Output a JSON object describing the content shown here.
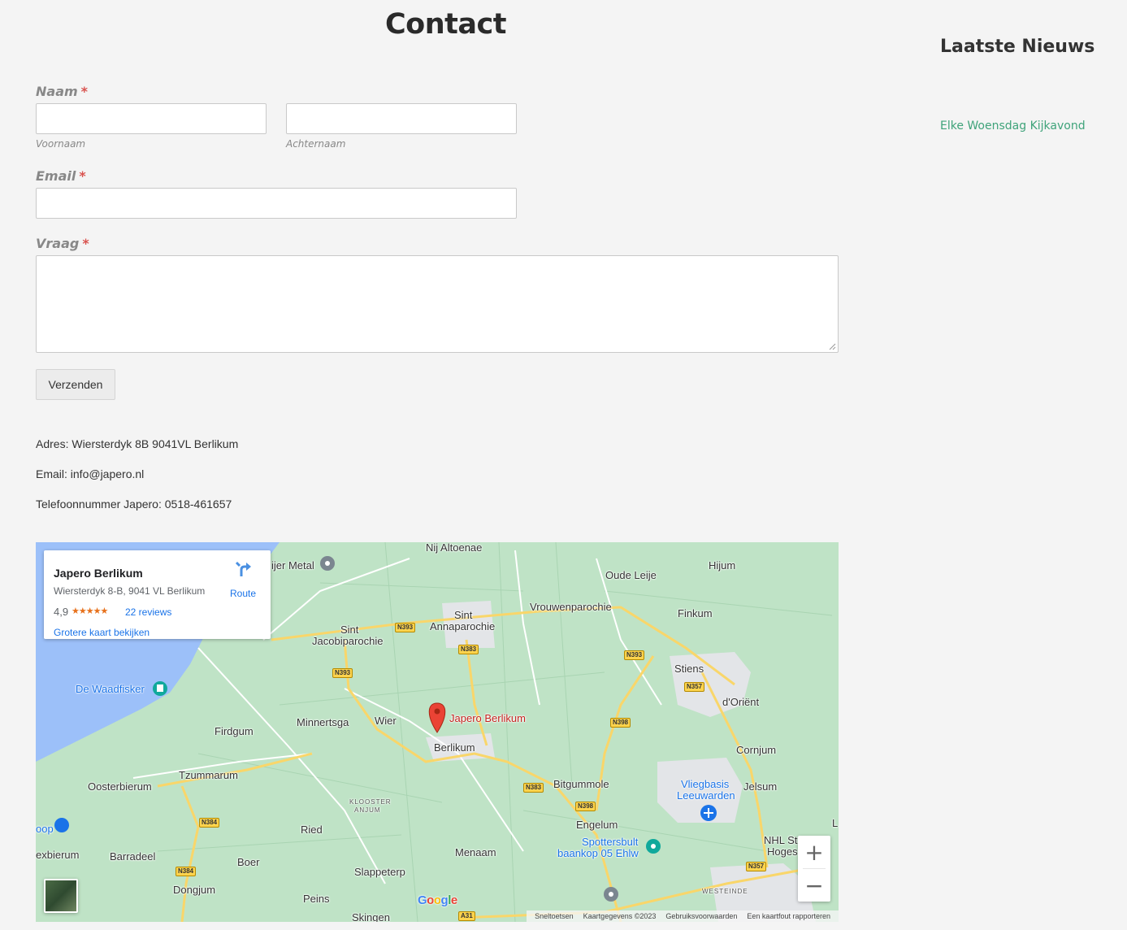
{
  "page": {
    "title": "Contact"
  },
  "form": {
    "name_label": "Naam",
    "required_mark": "*",
    "first_name_sublabel": "Voornaam",
    "last_name_sublabel": "Achternaam",
    "email_label": "Email",
    "question_label": "Vraag",
    "submit_label": "Verzenden"
  },
  "contact": {
    "address": "Adres: Wiersterdyk 8B 9041VL Berlikum",
    "email": "Email: info@japero.nl",
    "phone": "Telefoonnummer Japero: 0518-461657"
  },
  "sidebar": {
    "title": "Laatste Nieuws",
    "news_items": [
      {
        "label": "Elke Woensdag Kijkavond"
      }
    ]
  },
  "map": {
    "card": {
      "name": "Japero Berlikum",
      "address": "Wiersterdyk 8-B, 9041 VL Berlikum",
      "rating": "4,9",
      "stars": "★★★★★",
      "reviews": "22 reviews",
      "larger_map": "Grotere kaart bekijken",
      "route": "Route"
    },
    "marker_label": "Japero Berlikum",
    "places": {
      "nij_altoenae": "Nij Altoenae",
      "hijum": "Hijum",
      "oude_leije": "Oude Leije",
      "sint_annaparochie_1": "Sint",
      "sint_annaparochie_2": "Annaparochie",
      "vrouwenparochie": "Vrouwenparochie",
      "finkum": "Finkum",
      "sint_jacobi_1": "Sint",
      "sint_jacobi_2": "Jacobiparochie",
      "stiens": "Stiens",
      "de_waadfisker": "De Waadfisker",
      "d_orient": "d'Oriënt",
      "minnertsga": "Minnertsga",
      "wier": "Wier",
      "berlikum": "Berlikum",
      "firdgum": "Firdgum",
      "cornjum": "Cornjum",
      "tzummarum": "Tzummarum",
      "oosterbierum": "Oosterbierum",
      "bitgummole": "Bitgummole",
      "vliegbasis_1": "Vliegbasis",
      "vliegbasis_2": "Leeuwarden",
      "jelsum": "Jelsum",
      "klooster_1": "KLOOSTER",
      "klooster_2": "ANJUM",
      "engelum": "Engelum",
      "spottersbult_1": "Spottersbult",
      "spottersbult_2": "baankop 05 Ehlw",
      "ried": "Ried",
      "nhl_1": "NHL St",
      "nhl_2": "Hoges",
      "l_edge": "L",
      "oop": "oop",
      "exbierum": "exbierum",
      "barradeel": "Barradeel",
      "boer": "Boer",
      "menaam": "Menaam",
      "slappeterp": "Slappeterp",
      "dongjum": "Dongjum",
      "peins": "Peins",
      "skingen": "Skingen",
      "westeinde": "WESTEINDE",
      "metal": "ijer Metal"
    },
    "roads": {
      "n393_a": "N393",
      "n393_b": "N393",
      "n393_c": "N393",
      "n383_a": "N383",
      "n383_b": "N383",
      "n357_a": "N357",
      "n357_b": "N357",
      "n398_a": "N398",
      "n398_b": "N398",
      "n384_a": "N384",
      "n384_b": "N384",
      "a31": "A31"
    },
    "zoom_in": "+",
    "zoom_out": "−",
    "google": "Google",
    "footer": {
      "shortcuts": "Sneltoetsen",
      "data": "Kaartgegevens ©2023",
      "terms": "Gebruiksvoorwaarden",
      "report": "Een kaartfout rapporteren"
    },
    "colors": {
      "land": "#bfe3c6",
      "water": "#9cc0f9",
      "road": "#f9d66a",
      "urban": "#e3e5e8"
    }
  }
}
